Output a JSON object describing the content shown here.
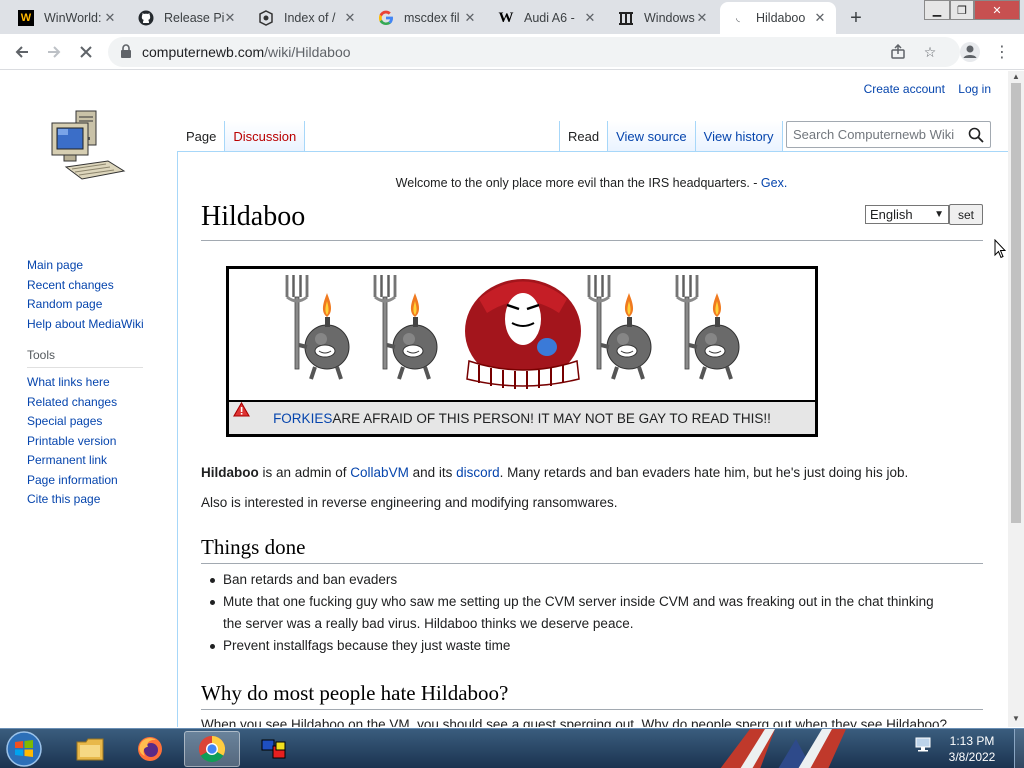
{
  "browser": {
    "tabs": [
      {
        "title": "WinWorld:",
        "icon": "winworld-icon",
        "active": false
      },
      {
        "title": "Release Pi",
        "icon": "github-icon",
        "active": false
      },
      {
        "title": "Index of /",
        "icon": "index-icon",
        "active": false
      },
      {
        "title": "mscdex fil",
        "icon": "google-icon",
        "active": false
      },
      {
        "title": "Audi A6 -",
        "icon": "wikipedia-icon",
        "active": false
      },
      {
        "title": "Windows",
        "icon": "archive-icon",
        "active": false
      },
      {
        "title": "Hildaboo",
        "icon": "loading-icon",
        "active": true
      }
    ],
    "url_host": "computernewb.com",
    "url_path": "/wiki/Hildaboo"
  },
  "wiki": {
    "user_links": [
      "Create account",
      "Log in"
    ],
    "page_tabs": {
      "page": "Page",
      "discussion": "Discussion",
      "read": "Read",
      "view_source": "View source",
      "view_history": "View history"
    },
    "search_placeholder": "Search Computernewb Wiki",
    "sidebar": {
      "nav": [
        "Main page",
        "Recent changes",
        "Random page",
        "Help about MediaWiki"
      ],
      "tools_heading": "Tools",
      "tools": [
        "What links here",
        "Related changes",
        "Special pages",
        "Printable version",
        "Permanent link",
        "Page information",
        "Cite this page"
      ]
    },
    "site_notice": "Welcome to the only place more evil than the IRS headquarters. - ",
    "site_notice_link": "Gex.",
    "language": "English",
    "set_label": "set",
    "title": "Hildaboo",
    "banner": {
      "link": "FORKIES",
      "text": " ARE AFRAID OF THIS PERSON! IT MAY NOT BE GAY TO READ THIS!!"
    },
    "intro": {
      "bold": "Hildaboo",
      "t1": " is an admin of ",
      "link1": "CollabVM",
      "t2": " and its ",
      "link2": "discord",
      "t3": ". Many retards and ban evaders hate him, but he's just doing his job."
    },
    "para2": "Also is interested in reverse engineering and modifying ransomwares.",
    "section1": "Things done",
    "section1_items": [
      "Ban retards and ban evaders",
      "Mute that one fucking guy who saw me setting up the CVM server inside CVM and was freaking out in the chat thinking",
      "the server was a really bad virus. Hildaboo thinks we deserve peace.",
      "Prevent installfags because they just waste time"
    ],
    "section2": "Why do most people hate Hildaboo?",
    "section2_partial": "When you see Hildaboo on the VM, you should see a guest sperging out. Why do people sperg out when they see Hildaboo?"
  },
  "taskbar": {
    "time": "1:13 PM",
    "date": "3/8/2022",
    "apps": [
      "explorer-icon",
      "firefox-icon",
      "chrome-icon",
      "media-app-icon"
    ]
  },
  "colors": {
    "link": "#0645ad",
    "redlink": "#ba0000",
    "accent_border": "#a7d7f9"
  }
}
